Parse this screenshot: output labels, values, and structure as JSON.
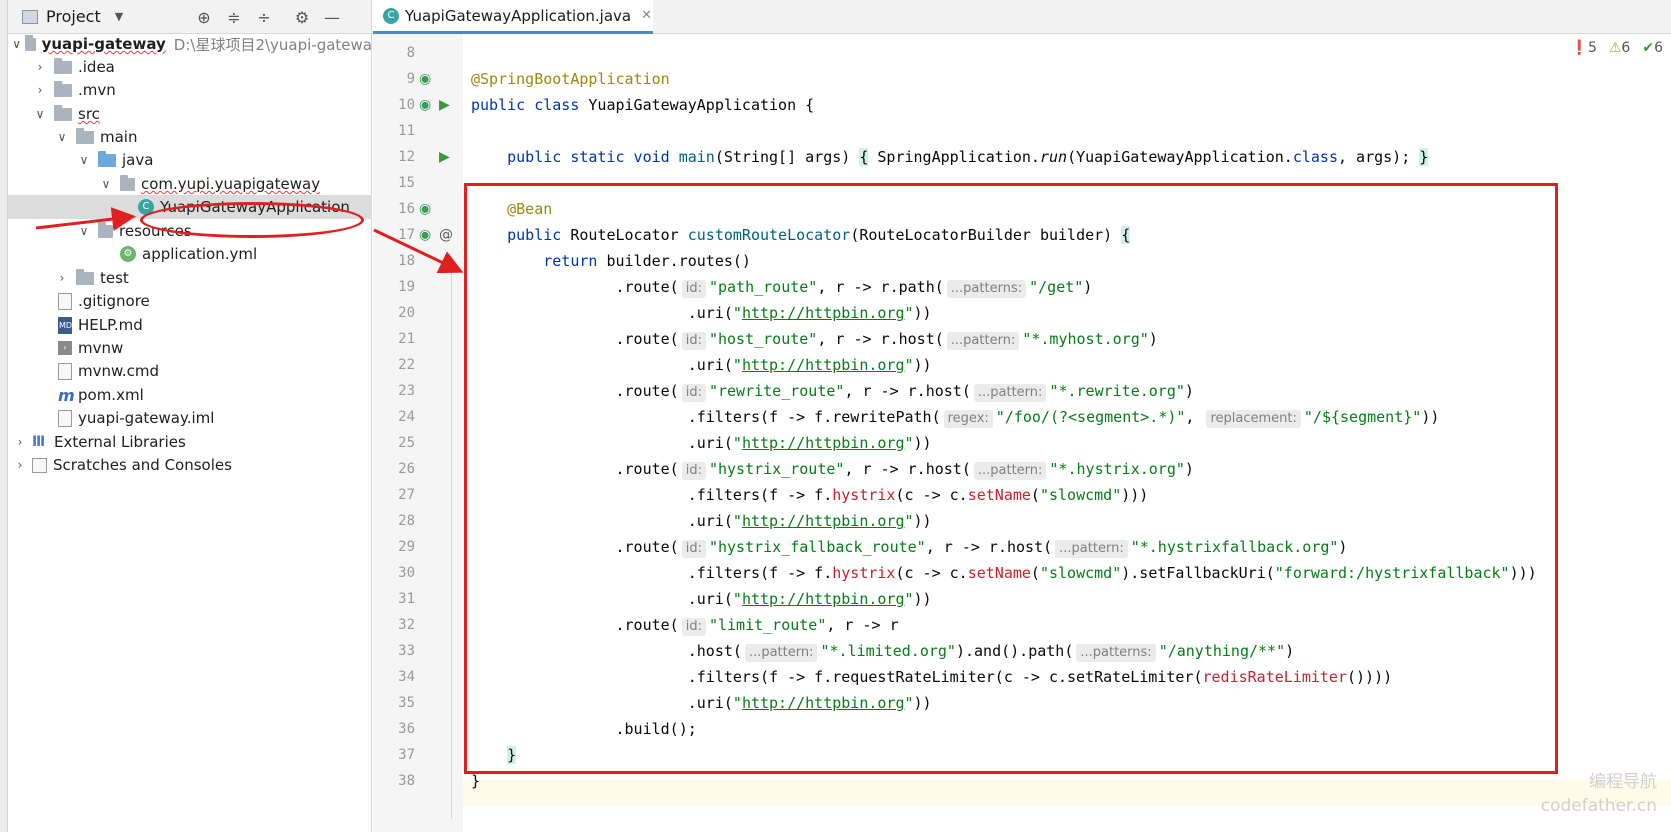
{
  "project_panel": {
    "title": "Project",
    "tree": [
      {
        "label": "yuapi-gateway",
        "path": "D:\\星球项目2\\yuapi-gatewa"
      },
      {
        "label": ".idea"
      },
      {
        "label": ".mvn"
      },
      {
        "label": "src"
      },
      {
        "label": "main"
      },
      {
        "label": "java"
      },
      {
        "label": "com.yupi.yuapigateway"
      },
      {
        "label": "YuapiGatewayApplication"
      },
      {
        "label": "resources"
      },
      {
        "label": "application.yml"
      },
      {
        "label": "test"
      },
      {
        "label": ".gitignore"
      },
      {
        "label": "HELP.md"
      },
      {
        "label": "mvnw"
      },
      {
        "label": "mvnw.cmd"
      },
      {
        "label": "pom.xml"
      },
      {
        "label": "yuapi-gateway.iml"
      },
      {
        "label": "External Libraries"
      },
      {
        "label": "Scratches and Consoles"
      }
    ]
  },
  "editor": {
    "tab_label": "YuapiGatewayApplication.java",
    "indicators": {
      "errors": "5",
      "warnings": "6",
      "ok": "6"
    },
    "line_numbers": [
      "8",
      "9",
      "10",
      "11",
      "12",
      "15",
      "16",
      "17",
      "18",
      "19",
      "20",
      "21",
      "22",
      "23",
      "24",
      "25",
      "26",
      "27",
      "28",
      "29",
      "30",
      "31",
      "32",
      "33",
      "34",
      "35",
      "36",
      "37",
      "38"
    ]
  },
  "watermark": {
    "line1": "编程导航",
    "line2": "codefather.cn"
  },
  "colors": {
    "highlight_box": "#e02020",
    "keyword": "#0033b3",
    "string": "#067d17",
    "annotation": "#9e880d"
  }
}
